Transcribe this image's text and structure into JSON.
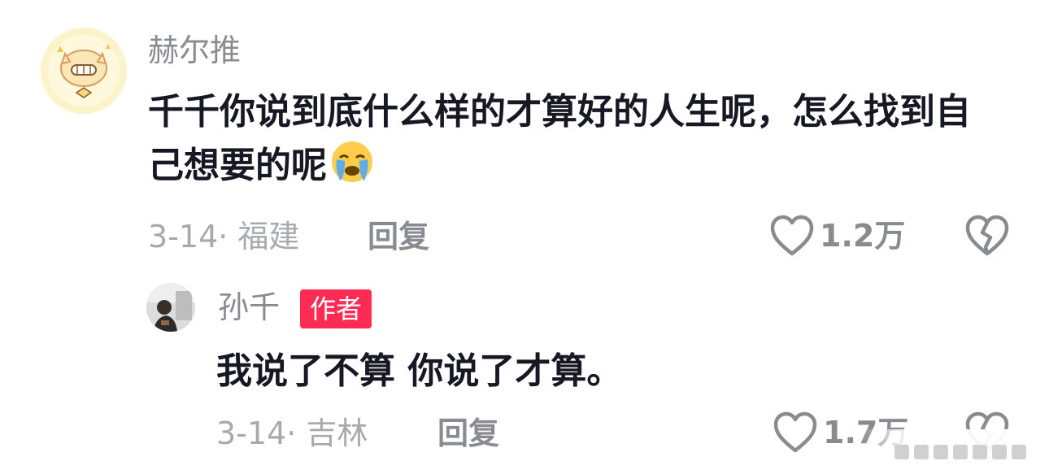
{
  "main_comment": {
    "username": "赫尔推",
    "text": "千千你说到底什么样的才算好的人生呢，怎么找到自己想要的呢",
    "emoji": "loudly-crying-face",
    "meta": "3-14· 福建",
    "reply_label": "回复",
    "like_count": "1.2万"
  },
  "reply_comment": {
    "username": "孙千",
    "badge": "作者",
    "text": "我说了不算 你说了才算。",
    "meta": "3-14· 吉林",
    "reply_label": "回复",
    "like_count": "1.7万"
  },
  "colors": {
    "name_gray": "#8a8b91",
    "meta_gray": "#a8a9ae",
    "badge_red": "#fe2c55",
    "text_dark": "#161823"
  }
}
